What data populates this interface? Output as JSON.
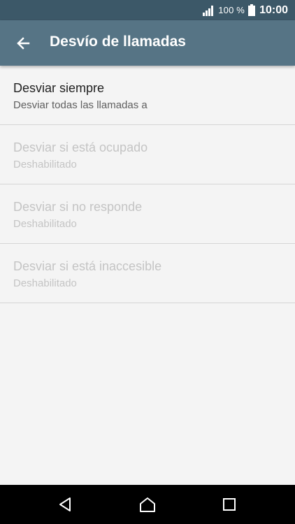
{
  "status_bar": {
    "signal_icon": "signal-icon",
    "battery_percent": "100 %",
    "battery_icon": "battery-icon",
    "time": "10:00"
  },
  "app_bar": {
    "back_icon": "arrow-left-icon",
    "title": "Desvío de llamadas"
  },
  "settings": [
    {
      "title": "Desviar siempre",
      "summary": "Desviar todas las llamadas a",
      "enabled": true
    },
    {
      "title": "Desviar si está ocupado",
      "summary": "Deshabilitado",
      "enabled": false
    },
    {
      "title": "Desviar si no responde",
      "summary": "Deshabilitado",
      "enabled": false
    },
    {
      "title": "Desviar si está inaccesible",
      "summary": "Deshabilitado",
      "enabled": false
    }
  ],
  "nav_bar": {
    "buttons": [
      "back-triangle-icon",
      "home-icon",
      "recents-icon"
    ]
  },
  "colors": {
    "status_bar": "#3c5868",
    "app_bar": "#567485",
    "background": "#f4f4f4",
    "text_primary": "#212121",
    "text_secondary": "#5f5f5f",
    "text_disabled": "#c4c4c4",
    "nav_bar": "#000000"
  }
}
